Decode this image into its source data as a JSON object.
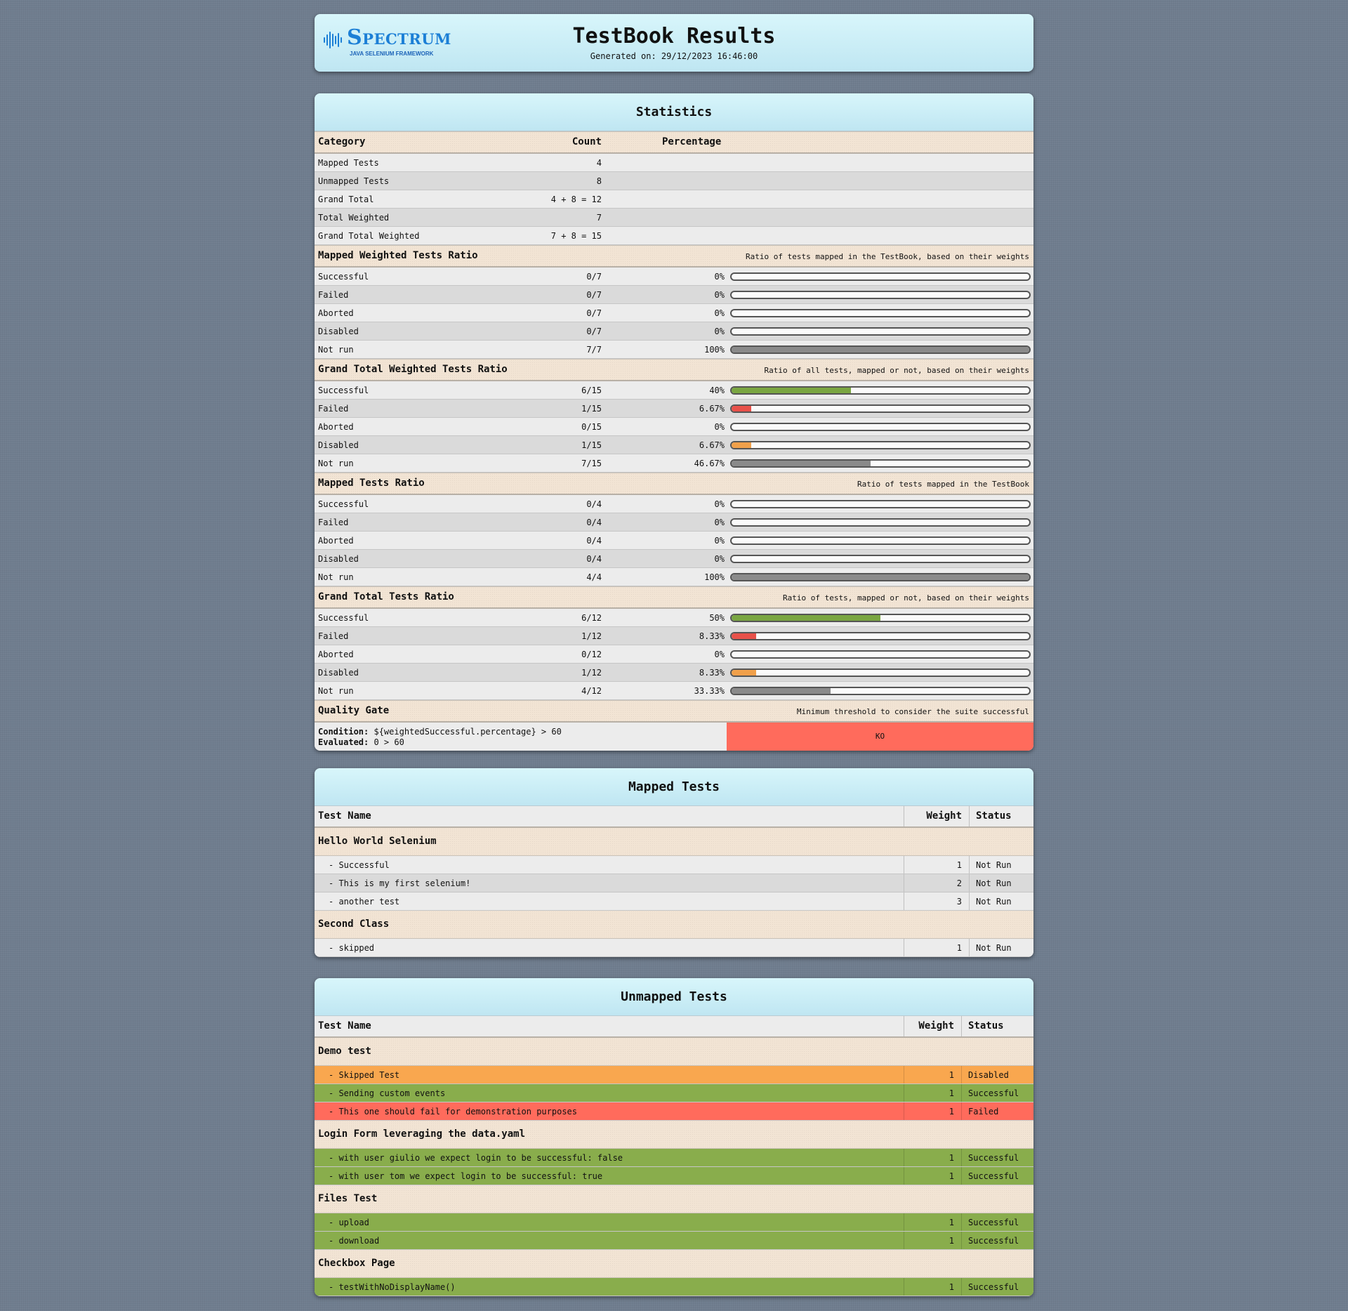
{
  "header": {
    "logo_word": "Spectrum",
    "logo_sub": "JAVA SELENIUM FRAMEWORK",
    "title": "TestBook Results",
    "generated": "Generated on: 29/12/2023 16:46:00"
  },
  "statistics": {
    "title": "Statistics",
    "columns": {
      "category": "Category",
      "count": "Count",
      "percentage": "Percentage"
    },
    "summary": [
      {
        "label": "Mapped Tests",
        "count": "4"
      },
      {
        "label": "Unmapped Tests",
        "count": "8"
      },
      {
        "label": "Grand Total",
        "count": "4 + 8 = 12"
      },
      {
        "label": "Total Weighted",
        "count": "7"
      },
      {
        "label": "Grand Total Weighted",
        "count": "7 + 8 = 15"
      }
    ],
    "sections": [
      {
        "title": "Mapped Weighted Tests Ratio",
        "description": "Ratio of tests mapped in the TestBook, based on their weights",
        "rows": [
          {
            "label": "Successful",
            "count": "0/7",
            "pct": "0%",
            "value": 0,
            "kind": "success"
          },
          {
            "label": "Failed",
            "count": "0/7",
            "pct": "0%",
            "value": 0,
            "kind": "fail"
          },
          {
            "label": "Aborted",
            "count": "0/7",
            "pct": "0%",
            "value": 0,
            "kind": "fail"
          },
          {
            "label": "Disabled",
            "count": "0/7",
            "pct": "0%",
            "value": 0,
            "kind": "disabled"
          },
          {
            "label": "Not run",
            "count": "7/7",
            "pct": "100%",
            "value": 100,
            "kind": "notrun"
          }
        ]
      },
      {
        "title": "Grand Total Weighted Tests Ratio",
        "description": "Ratio of all tests, mapped or not, based on their weights",
        "rows": [
          {
            "label": "Successful",
            "count": "6/15",
            "pct": "40%",
            "value": 40,
            "kind": "success"
          },
          {
            "label": "Failed",
            "count": "1/15",
            "pct": "6.67%",
            "value": 6.67,
            "kind": "fail"
          },
          {
            "label": "Aborted",
            "count": "0/15",
            "pct": "0%",
            "value": 0,
            "kind": "fail"
          },
          {
            "label": "Disabled",
            "count": "1/15",
            "pct": "6.67%",
            "value": 6.67,
            "kind": "disabled"
          },
          {
            "label": "Not run",
            "count": "7/15",
            "pct": "46.67%",
            "value": 46.67,
            "kind": "notrun"
          }
        ]
      },
      {
        "title": "Mapped Tests Ratio",
        "description": "Ratio of tests mapped in the TestBook",
        "rows": [
          {
            "label": "Successful",
            "count": "0/4",
            "pct": "0%",
            "value": 0,
            "kind": "success"
          },
          {
            "label": "Failed",
            "count": "0/4",
            "pct": "0%",
            "value": 0,
            "kind": "fail"
          },
          {
            "label": "Aborted",
            "count": "0/4",
            "pct": "0%",
            "value": 0,
            "kind": "fail"
          },
          {
            "label": "Disabled",
            "count": "0/4",
            "pct": "0%",
            "value": 0,
            "kind": "disabled"
          },
          {
            "label": "Not run",
            "count": "4/4",
            "pct": "100%",
            "value": 100,
            "kind": "notrun"
          }
        ]
      },
      {
        "title": "Grand Total Tests Ratio",
        "description": "Ratio of tests, mapped or not, based on their weights",
        "rows": [
          {
            "label": "Successful",
            "count": "6/12",
            "pct": "50%",
            "value": 50,
            "kind": "success"
          },
          {
            "label": "Failed",
            "count": "1/12",
            "pct": "8.33%",
            "value": 8.33,
            "kind": "fail"
          },
          {
            "label": "Aborted",
            "count": "0/12",
            "pct": "0%",
            "value": 0,
            "kind": "fail"
          },
          {
            "label": "Disabled",
            "count": "1/12",
            "pct": "8.33%",
            "value": 8.33,
            "kind": "disabled"
          },
          {
            "label": "Not run",
            "count": "4/12",
            "pct": "33.33%",
            "value": 33.33,
            "kind": "notrun"
          }
        ]
      }
    ],
    "quality_gate": {
      "title": "Quality Gate",
      "description": "Minimum threshold to consider the suite successful",
      "condition_label": "Condition:",
      "condition": "${weightedSuccessful.percentage} > 60",
      "evaluated_label": "Evaluated:",
      "evaluated": "0 > 60",
      "result": "KO"
    }
  },
  "mapped": {
    "title": "Mapped Tests",
    "columns": {
      "name": "Test Name",
      "weight": "Weight",
      "status": "Status"
    },
    "groups": [
      {
        "name": "Hello World Selenium",
        "tests": [
          {
            "name": "- Successful",
            "weight": "1",
            "status": "Not Run",
            "kind": "notrun"
          },
          {
            "name": "- This is my first selenium!",
            "weight": "2",
            "status": "Not Run",
            "kind": "notrun"
          },
          {
            "name": "- another test",
            "weight": "3",
            "status": "Not Run",
            "kind": "notrun"
          }
        ]
      },
      {
        "name": "Second Class",
        "tests": [
          {
            "name": "- skipped",
            "weight": "1",
            "status": "Not Run",
            "kind": "notrun"
          }
        ]
      }
    ]
  },
  "unmapped": {
    "title": "Unmapped Tests",
    "columns": {
      "name": "Test Name",
      "weight": "Weight",
      "status": "Status"
    },
    "groups": [
      {
        "name": "Demo test",
        "tests": [
          {
            "name": "- Skipped Test",
            "weight": "1",
            "status": "Disabled",
            "kind": "disabled"
          },
          {
            "name": "- Sending custom events",
            "weight": "1",
            "status": "Successful",
            "kind": "success"
          },
          {
            "name": "- This one should fail for demonstration purposes",
            "weight": "1",
            "status": "Failed",
            "kind": "failed"
          }
        ]
      },
      {
        "name": "Login Form leveraging the data.yaml",
        "tests": [
          {
            "name": "- with user giulio we expect login to be successful: false",
            "weight": "1",
            "status": "Successful",
            "kind": "success"
          },
          {
            "name": "- with user tom we expect login to be successful: true",
            "weight": "1",
            "status": "Successful",
            "kind": "success"
          }
        ]
      },
      {
        "name": "Files Test",
        "tests": [
          {
            "name": "- upload",
            "weight": "1",
            "status": "Successful",
            "kind": "success"
          },
          {
            "name": "- download",
            "weight": "1",
            "status": "Successful",
            "kind": "success"
          }
        ]
      },
      {
        "name": "Checkbox Page",
        "tests": [
          {
            "name": "- testWithNoDisplayName()",
            "weight": "1",
            "status": "Successful",
            "kind": "success"
          }
        ]
      }
    ]
  },
  "colors": {
    "success": "#89ad4c",
    "failed": "#ff6b5c",
    "disabled": "#f9a74f",
    "notrun": "#8a8a8a",
    "header_accent": "#d8f6fb"
  }
}
